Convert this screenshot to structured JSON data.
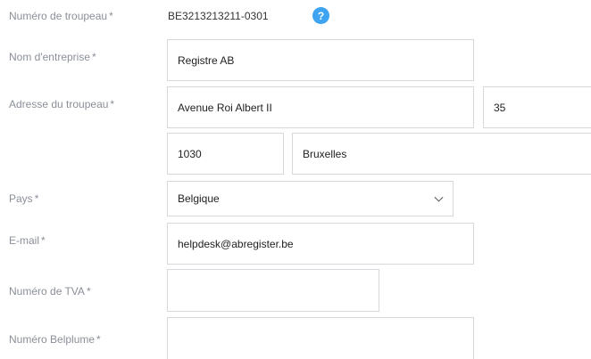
{
  "form": {
    "required_marker": "*",
    "herd_number": {
      "label": "Numéro de troupeau",
      "value": "BE3213213211-0301",
      "help_icon": "?"
    },
    "company_name": {
      "label": "Nom d'entreprise",
      "value": "Registre AB"
    },
    "herd_address": {
      "label": "Adresse du troupeau",
      "street": "Avenue Roi Albert II",
      "number": "35",
      "postal_code": "1030",
      "city": "Bruxelles"
    },
    "country": {
      "label": "Pays",
      "value": "Belgique"
    },
    "email": {
      "label": "E-mail",
      "value": "helpdesk@abregister.be"
    },
    "vat_number": {
      "label": "Numéro de TVA",
      "value": ""
    },
    "belplume_number": {
      "label": "Numéro Belplume",
      "value": ""
    }
  },
  "colors": {
    "label": "#8a8f98",
    "border": "#d6d8db",
    "help_badge": "#3ea3f0"
  }
}
